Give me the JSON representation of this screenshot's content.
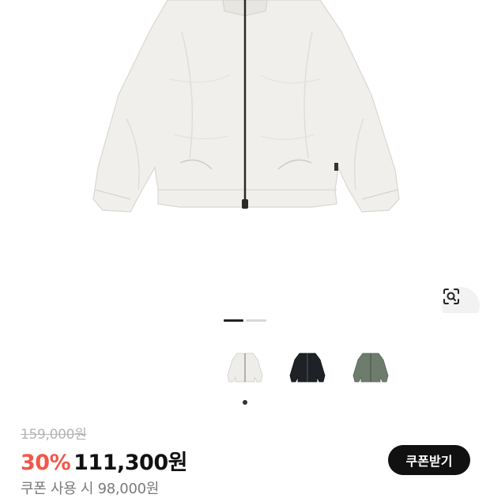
{
  "product": {
    "image": {
      "alt": "white zip-up jacket",
      "color": "#f1efec"
    },
    "carousel": {
      "total": 2,
      "active": 1
    },
    "lens_icon": "lens-search-icon",
    "colors": [
      {
        "name": "white",
        "hex": "#efedea",
        "selected": true
      },
      {
        "name": "black",
        "hex": "#1e2125",
        "selected": false
      },
      {
        "name": "green",
        "hex": "#6e7c6d",
        "selected": false
      }
    ]
  },
  "pricing": {
    "original_price": "159,000원",
    "discount_rate": "30%",
    "sale_price": "111,300원",
    "coupon_button": "쿠폰받기",
    "coupon_price": "쿠폰 사용 시 98,000원"
  }
}
